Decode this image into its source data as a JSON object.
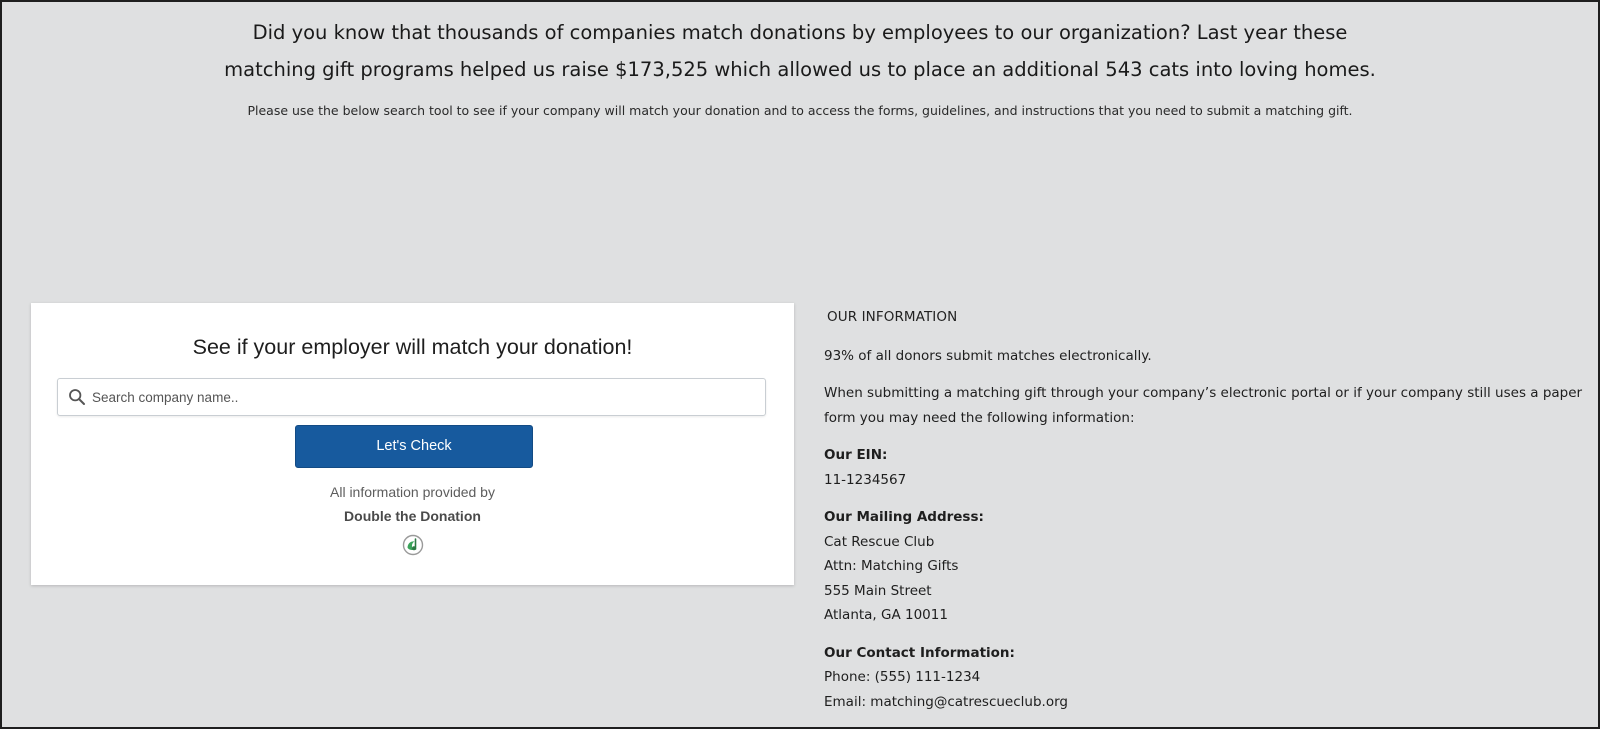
{
  "intro": {
    "headline": "Did you know that thousands of companies match donations by employees to our organization? Last year these matching gift programs helped us raise $173,525 which allowed us to place an additional 543 cats into loving homes.",
    "instructions": "Please use the below search tool to see if your company will match your donation and to access the forms, guidelines, and instructions that you need to submit a matching gift."
  },
  "widget": {
    "title": "See if your employer will match your donation!",
    "search_placeholder": "Search company name..",
    "search_value": "",
    "button_label": "Let's Check",
    "provided_by": "All information provided by",
    "provider_name": "Double the Donation",
    "search_icon": "search-icon",
    "provider_logo": "double-the-donation-logo",
    "button_color": "#175a9e"
  },
  "info": {
    "heading": "OUR INFORMATION",
    "stat": "93% of all donors submit matches electronically.",
    "submission_note": "When submitting a matching gift through your company’s electronic portal or if your company still uses a paper form you may need the following information:",
    "ein_label": "Our EIN:",
    "ein_value": "11-1234567",
    "mailing_label": "Our Mailing Address:",
    "mailing_lines": [
      "Cat Rescue Club",
      "Attn: Matching Gifts",
      "555 Main Street",
      "Atlanta, GA 10011"
    ],
    "contact_label": "Our Contact Information:",
    "phone": "Phone: (555) 111-1234",
    "email": "Email: matching@catrescueclub.org"
  },
  "colors": {
    "page_background": "#dfe0e1",
    "card_background": "#ffffff",
    "logo_green": "#3aa35a"
  }
}
